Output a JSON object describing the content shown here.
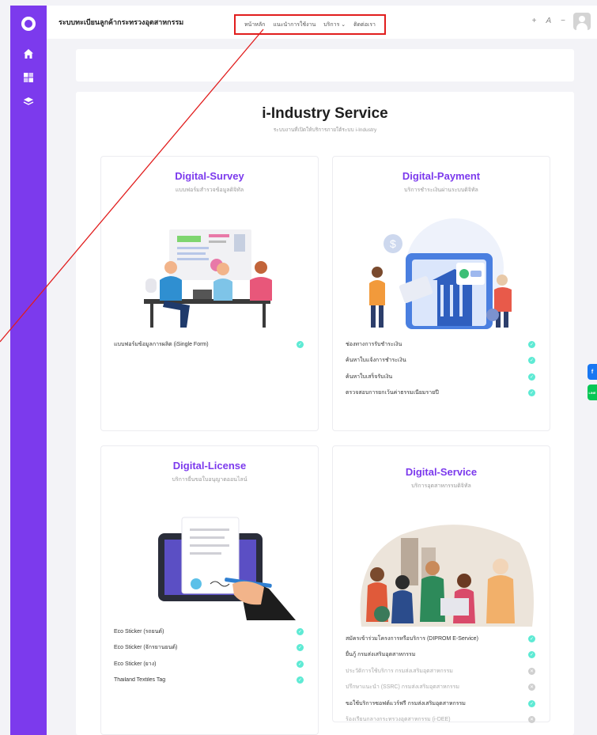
{
  "topbar": {
    "brand": "ระบบทะเบียนลูกค้ากระทรวงอุตสาหกรรม",
    "nav": [
      "หน้าหลัก",
      "แนะนำการใช้งาน",
      "บริการ ⌄",
      "ติดต่อเรา"
    ],
    "tools": [
      "+",
      "A",
      "−"
    ]
  },
  "sidebar": {
    "icons": [
      "home-icon",
      "dashboard-icon",
      "layers-icon"
    ]
  },
  "main": {
    "title": "i-Industry Service",
    "subtitle": "ระบบงานที่เปิดให้บริการภายใต้ระบบ i-Industry"
  },
  "services": [
    {
      "title": "Digital-Survey",
      "subtitle": "แบบฟอร์มสำรวจข้อมูลดิจิทัล",
      "items": [
        {
          "label": "แบบฟอร์มข้อมูลการผลิต (iSingle Form)",
          "enabled": true
        }
      ]
    },
    {
      "title": "Digital-Payment",
      "subtitle": "บริการชำระเงินผ่านระบบดิจิทัล",
      "items": [
        {
          "label": "ช่องทางการรับชำระเงิน",
          "enabled": true
        },
        {
          "label": "ค้นหาใบแจ้งการชำระเงิน",
          "enabled": true
        },
        {
          "label": "ค้นหาใบเสร็จรับเงิน",
          "enabled": true
        },
        {
          "label": "ตรวจสอบการยกเว้นค่าธรรมเนียมรายปี",
          "enabled": true
        }
      ]
    },
    {
      "title": "Digital-License",
      "subtitle": "บริการยื่นขอใบอนุญาตออนไลน์",
      "items": [
        {
          "label": "Eco Sticker (รถยนต์)",
          "enabled": true
        },
        {
          "label": "Eco Sticker (จักรยานยนต์)",
          "enabled": true
        },
        {
          "label": "Eco Sticker (ยาง)",
          "enabled": true
        },
        {
          "label": "Thailand Textiles Tag",
          "enabled": true
        }
      ]
    },
    {
      "title": "Digital-Service",
      "subtitle": "บริการอุตสาหกรรมดิจิทัล",
      "items": [
        {
          "label": "สมัครเข้าร่วมโครงการหรือบริการ (DIPROM E-Service)",
          "enabled": true
        },
        {
          "label": "ยื่นกู้ กรมส่งเสริมอุตสาหกรรม",
          "enabled": true
        },
        {
          "label": "ประวัติการใช้บริการ กรมส่งเสริมอุตสาหกรรม",
          "enabled": false
        },
        {
          "label": "ปรึกษาแนะนำ (SSRC) กรมส่งเสริมอุตสาหกรรม",
          "enabled": false
        },
        {
          "label": "ขอใช้บริการซอฟต์แวร์ฟรี กรมส่งเสริมอุตสาหกรรม",
          "enabled": true
        },
        {
          "label": "ร้องเรียนกลางกระทรวงอุตสาหกรรม (i-DEE)",
          "enabled": false
        }
      ]
    }
  ],
  "floating": [
    {
      "name": "facebook-button",
      "label": "f",
      "color": "#1877f2"
    },
    {
      "name": "line-button",
      "label": "LINE",
      "color": "#06c755"
    }
  ],
  "colors": {
    "accent": "#7c3aed",
    "check": "#5eead4",
    "annotation": "#e11d1d"
  }
}
